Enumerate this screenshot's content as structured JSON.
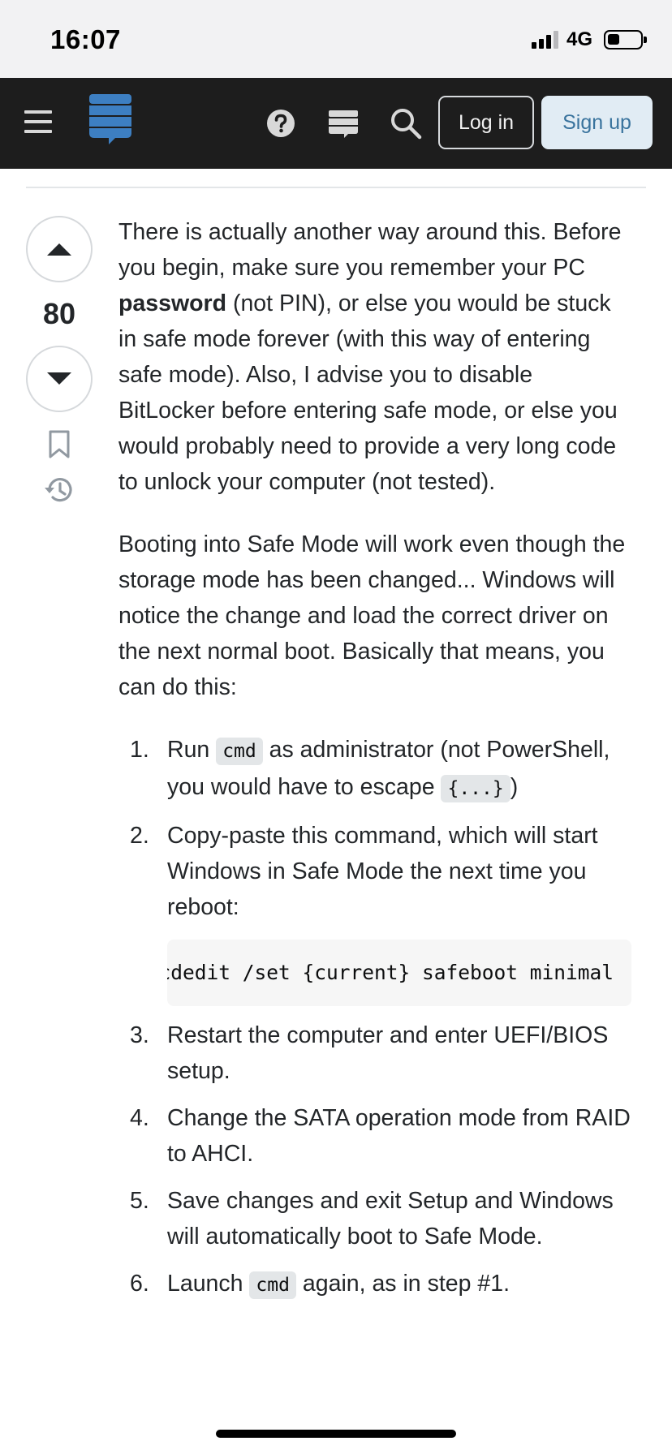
{
  "status_bar": {
    "time": "16:07",
    "network": "4G"
  },
  "header": {
    "login_label": "Log in",
    "signup_label": "Sign up"
  },
  "vote": {
    "count": "80"
  },
  "answer": {
    "p1_before": "There is actually another way around this. Before you begin, make sure you remember your PC ",
    "p1_bold": "password",
    "p1_after": " (not PIN), or else you would be stuck in safe mode forever (with this way of entering safe mode). Also, I advise you to disable BitLocker before entering safe mode, or else you would probably need to provide a very long code to unlock your computer (not tested).",
    "p2": "Booting into Safe Mode will work even though the storage mode has been changed... Windows will notice the change and load the correct driver on the next normal boot. Basically that means, you can do this:",
    "steps": [
      {
        "num": "1.",
        "pre": "Run ",
        "code": "cmd",
        "mid": " as administrator (not PowerShell, you would have to escape ",
        "code2": "{...}",
        "post": ")"
      },
      {
        "num": "2.",
        "text": "Copy-paste this command, which will start Windows in Safe Mode the next time you reboot:",
        "code_block": "bcdedit /set {current} safeboot minimal"
      },
      {
        "num": "3.",
        "text": "Restart the computer and enter UEFI/BIOS setup."
      },
      {
        "num": "4.",
        "text": "Change the SATA operation mode from RAID to AHCI."
      },
      {
        "num": "5.",
        "text": "Save changes and exit Setup and Windows will automatically boot to Safe Mode."
      },
      {
        "num": "6.",
        "pre": "Launch ",
        "code": "cmd",
        "post": " again, as in step #1."
      }
    ]
  },
  "colors": {
    "topbar": "#1d1d1d",
    "signup_bg": "#e1ecf4",
    "signup_text": "#39739d",
    "logo_blue": "#3d7fc2"
  }
}
